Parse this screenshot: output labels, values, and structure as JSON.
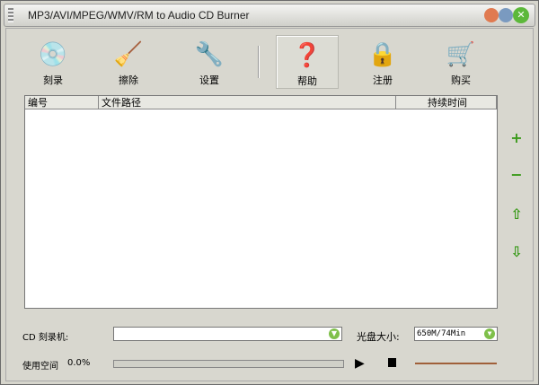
{
  "title": "MP3/AVI/MPEG/WMV/RM to Audio CD Burner",
  "toolbar": [
    {
      "label": "刻录",
      "icon": "💿"
    },
    {
      "label": "擦除",
      "icon": "🧹"
    },
    {
      "label": "设置",
      "icon": "🔧"
    },
    {
      "label": "帮助",
      "icon": "❓"
    },
    {
      "label": "注册",
      "icon": "🔒"
    },
    {
      "label": "购买",
      "icon": "🛒"
    }
  ],
  "list": {
    "columns": [
      "编号",
      "文件路径",
      "持续时间"
    ]
  },
  "side": {
    "add": "+",
    "remove": "−",
    "up": "⇧",
    "down": "⇩"
  },
  "bottom": {
    "burner_label": "CD 刻录机:",
    "burner_value": "",
    "size_label": "光盘大小:",
    "size_value": "650M/74Min",
    "used_label": "使用空间",
    "used_value": "0.0%",
    "used_progress": 0
  }
}
